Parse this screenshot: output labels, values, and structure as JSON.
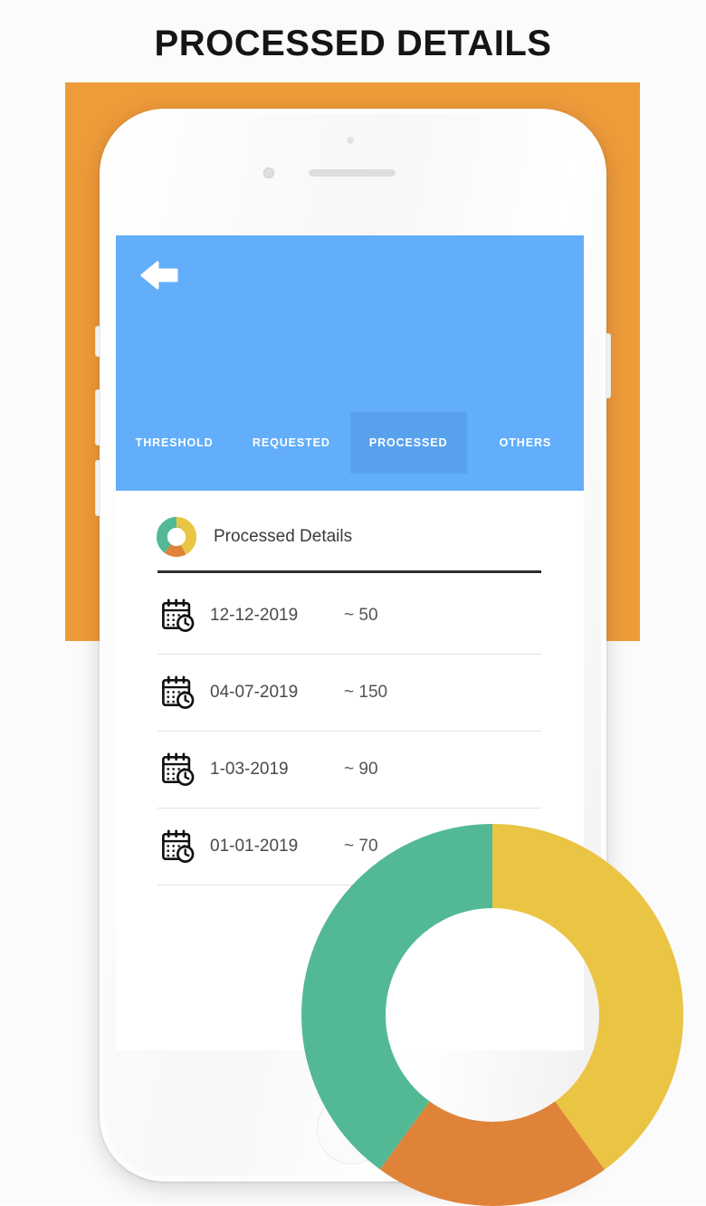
{
  "page": {
    "title": "PROCESSED DETAILS",
    "background_color": "#fbfbfb",
    "accent_orange": "#ee9b3a",
    "accent_blue": "#62aefa"
  },
  "app": {
    "header": {
      "back_icon": "arrow-left-icon",
      "background_color": "#62aefa"
    },
    "tabs": [
      {
        "label": "THRESHOLD",
        "selected": false
      },
      {
        "label": "REQUESTED",
        "selected": false
      },
      {
        "label": "PROCESSED",
        "selected": true
      },
      {
        "label": "OTHERS",
        "selected": false
      }
    ],
    "section": {
      "icon": "donut-chart-icon",
      "title": "Processed Details"
    },
    "rows": [
      {
        "icon": "calendar-clock-icon",
        "date": "12-12-2019",
        "value": "~ 50"
      },
      {
        "icon": "calendar-clock-icon",
        "date": "04-07-2019",
        "value": "~ 150"
      },
      {
        "icon": "calendar-clock-icon",
        "date": "1-03-2019",
        "value": "~ 90"
      },
      {
        "icon": "calendar-clock-icon",
        "date": "01-01-2019",
        "value": "~ 70"
      }
    ]
  },
  "chart_data": {
    "type": "pie",
    "title": "Processed Details",
    "subtype": "donut",
    "hole_ratio": 0.56,
    "start_angle_deg": 0,
    "direction": "clockwise",
    "labels": [
      "Yellow segment",
      "Orange segment",
      "Green segment"
    ],
    "values": [
      40,
      20,
      40
    ],
    "colors": [
      "#eac443",
      "#df8339",
      "#53b994"
    ],
    "segments": [
      {
        "label": "Yellow segment",
        "color": "#eac443",
        "value": 40,
        "start_deg": 0,
        "end_deg": 144
      },
      {
        "label": "Orange segment",
        "color": "#df8339",
        "value": 20,
        "start_deg": 144,
        "end_deg": 216
      },
      {
        "label": "Green segment",
        "color": "#53b994",
        "value": 40,
        "start_deg": 216,
        "end_deg": 360
      }
    ],
    "legend": "none",
    "grid": false
  },
  "mini_chart_data": {
    "type": "pie",
    "subtype": "donut",
    "values": [
      42,
      18,
      40
    ],
    "colors": [
      "#eac443",
      "#df8339",
      "#53b994"
    ],
    "labels": [
      "Yellow segment",
      "Orange segment",
      "Green segment"
    ]
  }
}
